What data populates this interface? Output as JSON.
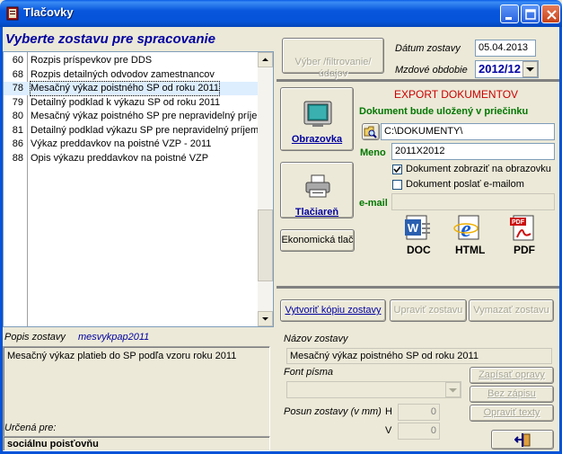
{
  "window": {
    "title": "Tlačovky"
  },
  "left": {
    "heading": "Vyberte zostavu pre spracovanie",
    "reports": [
      {
        "code": "60",
        "name": "Rozpis príspevkov pre DDS"
      },
      {
        "code": "68",
        "name": "Rozpis detailných odvodov zamestnancov"
      },
      {
        "code": "78",
        "name": "Mesačný výkaz poistného SP  od roku 2011"
      },
      {
        "code": "79",
        "name": "Detailný podklad k výkazu SP od roku 2011"
      },
      {
        "code": "80",
        "name": "Mesačný výkaz poistného SP pre nepravidelný príjem"
      },
      {
        "code": "81",
        "name": "Detailný podklad výkazu SP pre nepravidelný príjem"
      },
      {
        "code": "86",
        "name": "Výkaz preddavkov na poistné VZP - 2011"
      },
      {
        "code": "88",
        "name": "Opis výkazu preddavkov na poistné VZP"
      }
    ],
    "selected_index": 2,
    "description_label": "Popis zostavy",
    "report_id": "mesvykpap2011",
    "description": "Mesačný výkaz platieb do SP podľa vzoru roku 2011",
    "intended_label": "Určená pre:",
    "intended_value": "sociálnu poisťovňu"
  },
  "right": {
    "filter_button": "Výber /filtrovanie/\núdajov",
    "date_label": "Dátum zostavy",
    "date_value": "05.04.2013",
    "period_label": "Mzdové obdobie",
    "period_value": "2012/12",
    "screen_button": "Obrazovka",
    "printer_button": "Tlačiareň",
    "eco_print_button": "Ekonomická tlač",
    "export": {
      "title": "EXPORT DOKUMENTOV",
      "location_label": "Dokument bude uložený v priečinku",
      "folder": "C:\\DOKUMENTY\\",
      "name_label": "Meno",
      "name_value": "2011X2012",
      "show_on_screen": "Dokument zobraziť na obrazovku",
      "send_email": "Dokument poslať e-mailom",
      "email_label": "e-mail",
      "email_value": "",
      "formats": [
        "DOC",
        "HTML",
        "PDF"
      ]
    },
    "copy_button": "Vytvoriť kópiu zostavy",
    "edit_button": "Upraviť zostavu",
    "delete_button": "Vymazať zostavu",
    "report_name_label": "Názov zostavy",
    "report_name_value": "Mesačný výkaz poistného SP  od roku 2011",
    "font_label": "Font písma",
    "shift_label": "Posun zostavy (v mm)",
    "h_label": "H",
    "h_value": "0",
    "v_label": "V",
    "v_value": "0",
    "save_changes_button": "Zapísať opravy",
    "no_save_button": "Bez zápisu",
    "edit_texts_button": "Opraviť texty",
    "colors": {
      "accent_red": "#cc0000",
      "green": "#007700",
      "navy": "#0000a0"
    }
  }
}
